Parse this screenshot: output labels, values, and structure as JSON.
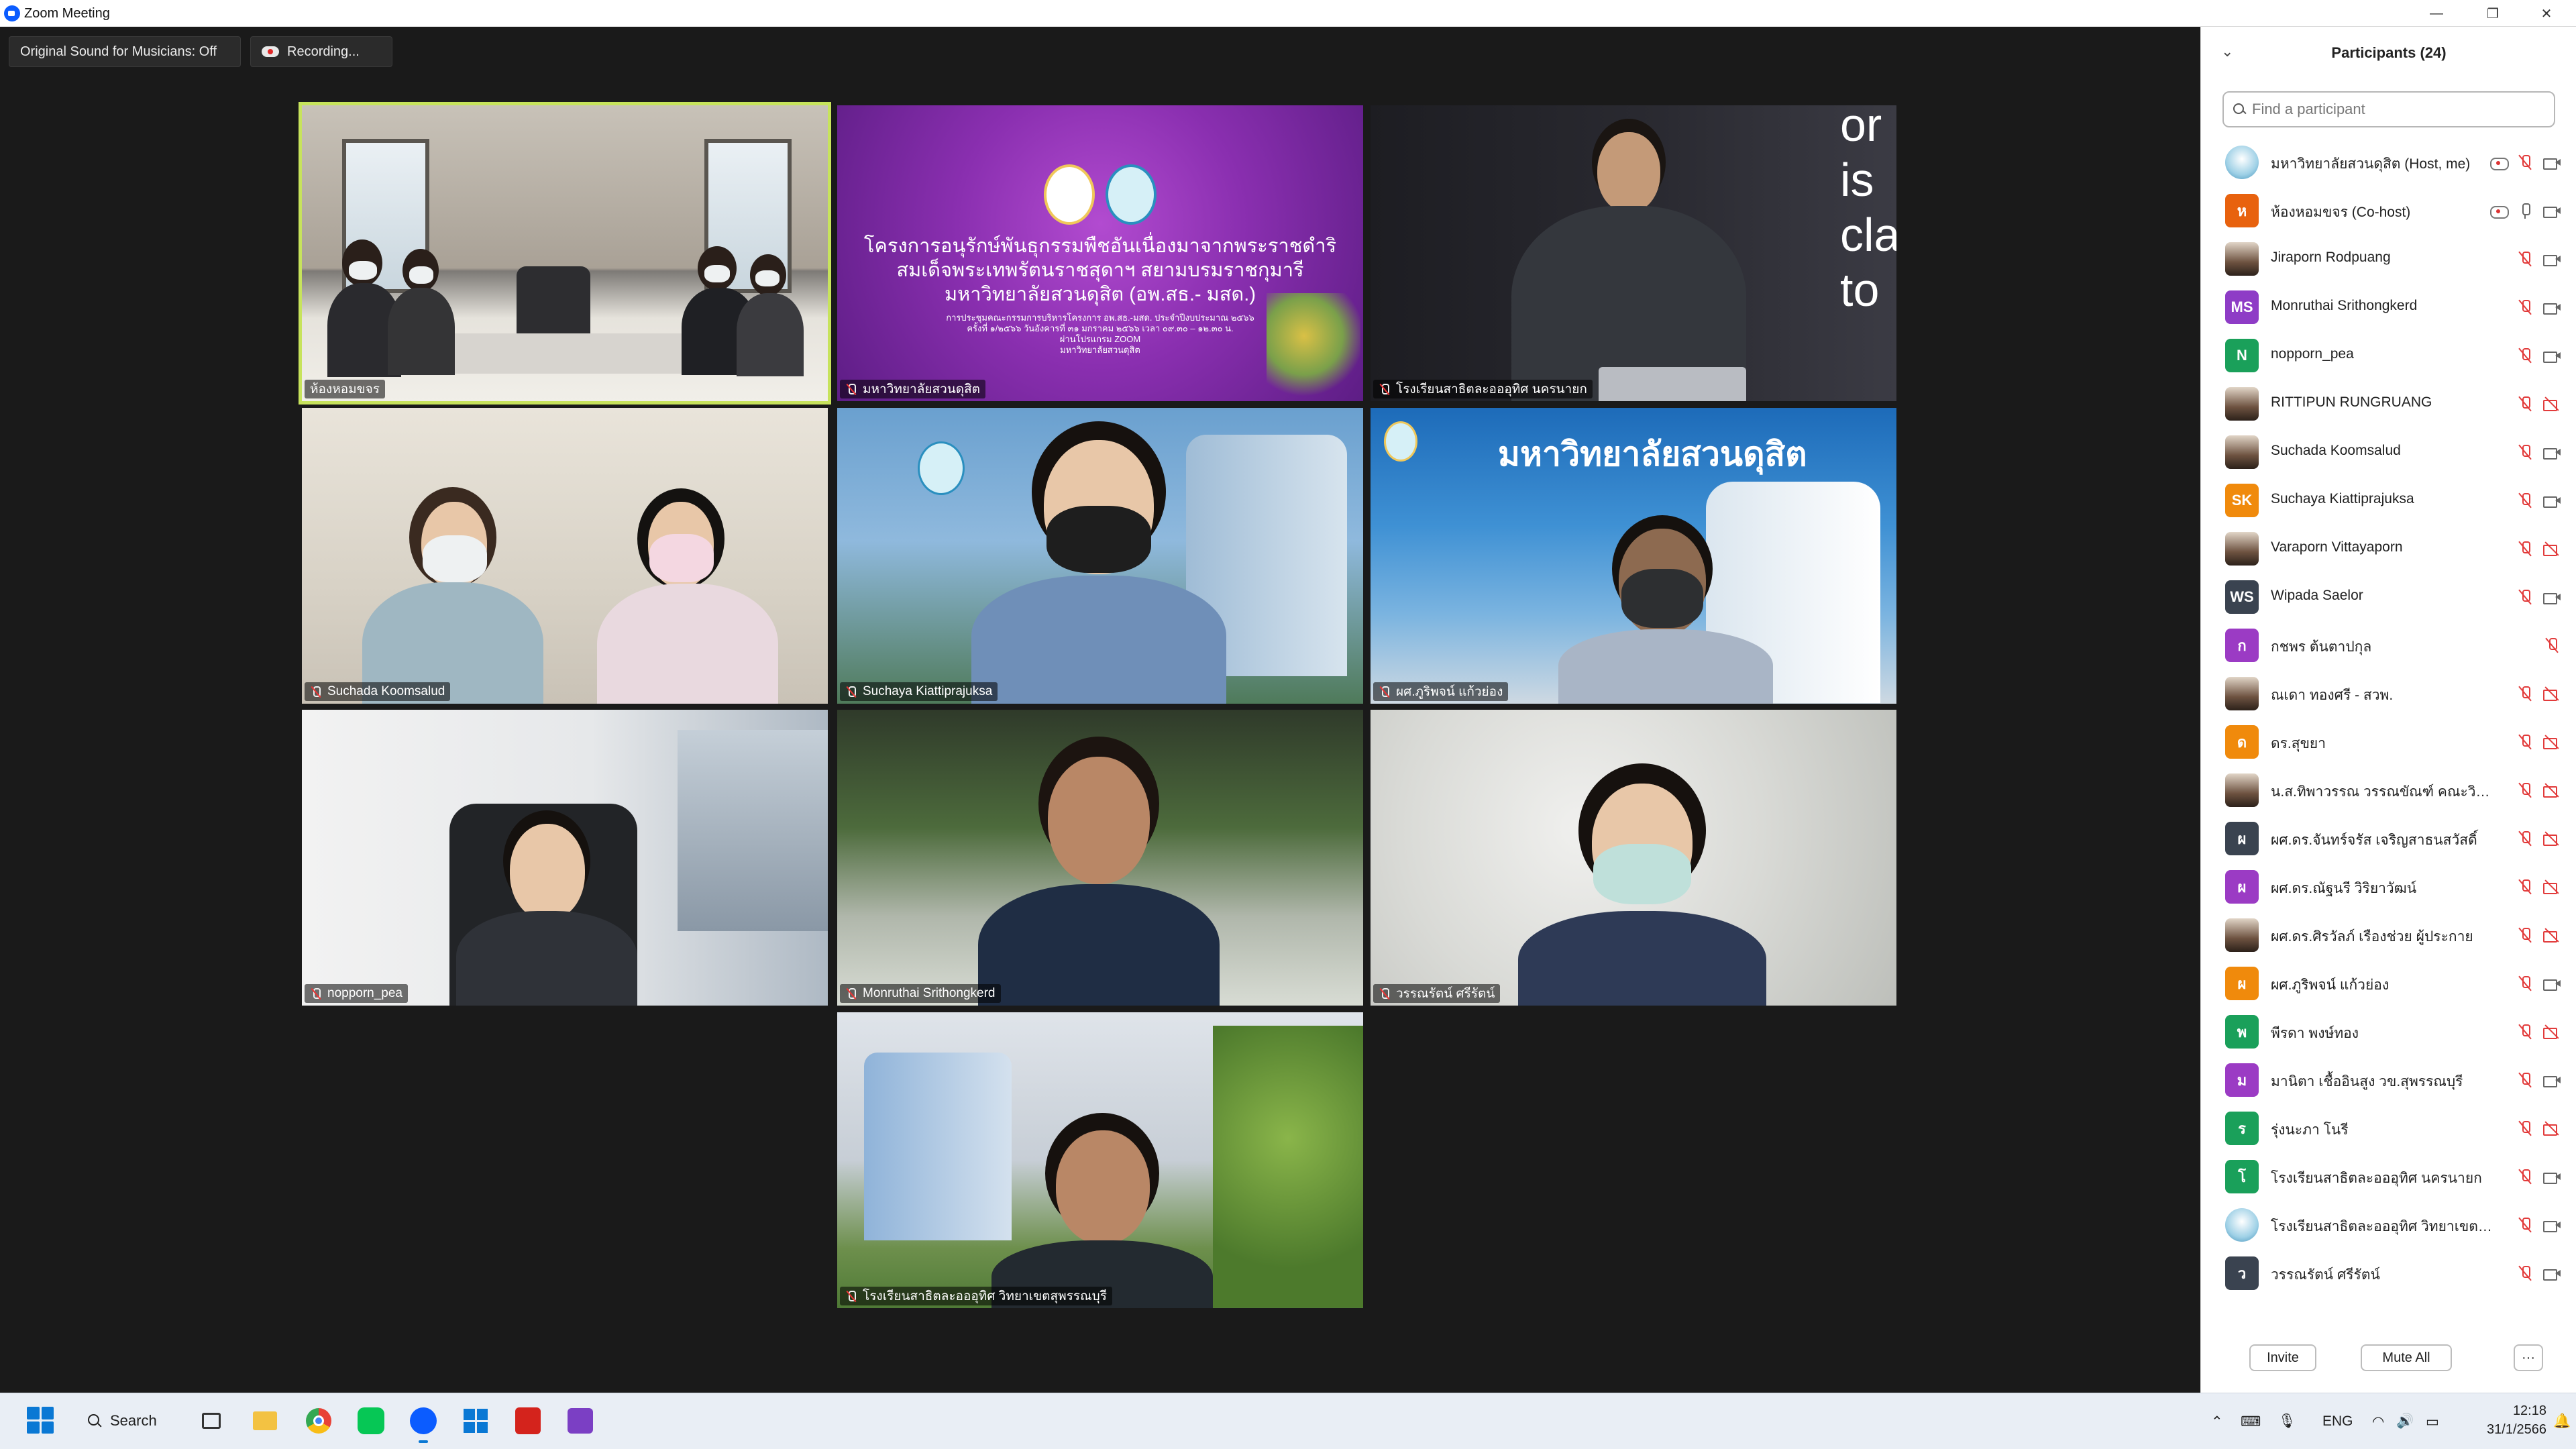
{
  "window": {
    "title": "Zoom Meeting"
  },
  "meeting": {
    "sound_label": "Original Sound for Musicians: Off",
    "recording_label": "Recording...",
    "slide": {
      "line1": "โครงการอนุรักษ์พันธุกรรมพืชอันเนื่องมาจากพระราชดำริ",
      "line2": "สมเด็จพระเทพรัตนราชสุดาฯ สยามบรมราชกุมารี",
      "line3": "มหาวิทยาลัยสวนดุสิต (อพ.สธ.- มสด.)",
      "small1": "การประชุมคณะกรรมการบริหารโครงการ อพ.สธ.-มสด. ประจำปีงบประมาณ ๒๕๖๖",
      "small2": "ครั้งที่ ๑/๒๕๖๖ วันอังคารที่ ๓๑ มกราคม ๒๕๖๖ เวลา ๐๙.๓๐ – ๑๒.๓๐ น.",
      "small3": "ผ่านโปรแกรม ZOOM",
      "small4": "มหาวิทยาลัยสวนดุสิต"
    },
    "board_text": [
      "or",
      "is",
      "cla",
      "to"
    ],
    "banner_text": "มหาวิทยาลัยสวนดุสิต",
    "tiles": [
      {
        "name": "ห้องหอมขจร",
        "muted": false,
        "active": true
      },
      {
        "name": "มหาวิทยาลัยสวนดุสิต",
        "muted": true
      },
      {
        "name": "โรงเรียนสาธิตละอออุทิศ นครนายก",
        "muted": true
      },
      {
        "name": "Suchada Koomsalud",
        "muted": true
      },
      {
        "name": "Suchaya Kiattiprajuksa",
        "muted": true
      },
      {
        "name": "ผศ.ภูริพจน์ แก้วย่อง",
        "muted": true
      },
      {
        "name": "nopporn_pea",
        "muted": true
      },
      {
        "name": "Monruthai Srithongkerd",
        "muted": true
      },
      {
        "name": "วรรณรัตน์ ศรีรัตน์",
        "muted": true
      },
      {
        "name": "โรงเรียนสาธิตละอออุทิศ วิทยาเขตสุพรรณบุรี",
        "muted": true
      }
    ]
  },
  "panel": {
    "title": "Participants (24)",
    "search_placeholder": "Find a participant",
    "participants": [
      {
        "name": "มหาวิทยาลัยสวนดุสิต (Host, me)",
        "avatar": "",
        "avatar_color": "#5aa7d0",
        "avatar_type": "photo-round",
        "icons": [
          "rec",
          "micoff",
          "vid"
        ]
      },
      {
        "name": "ห้องหอมขจร (Co-host)",
        "avatar": "ห",
        "avatar_color": "#e8620e",
        "avatar_type": "letter",
        "icons": [
          "rec",
          "mic",
          "vid"
        ]
      },
      {
        "name": "Jiraporn Rodpuang",
        "avatar": "",
        "avatar_color": "#ffffff",
        "avatar_type": "photo",
        "icons": [
          "micoff",
          "vid"
        ]
      },
      {
        "name": "Monruthai Srithongkerd",
        "avatar": "MS",
        "avatar_color": "#8e3cc6",
        "avatar_type": "letter",
        "icons": [
          "micoff",
          "vid"
        ]
      },
      {
        "name": "nopporn_pea",
        "avatar": "N",
        "avatar_color": "#1aa05a",
        "avatar_type": "letter",
        "icons": [
          "micoff",
          "vid"
        ]
      },
      {
        "name": "RITTIPUN RUNGRUANG",
        "avatar": "",
        "avatar_color": "#555555",
        "avatar_type": "photo",
        "icons": [
          "micoff",
          "vidoff"
        ]
      },
      {
        "name": "Suchada Koomsalud",
        "avatar": "",
        "avatar_color": "#ffffff",
        "avatar_type": "photo",
        "icons": [
          "micoff",
          "vid"
        ]
      },
      {
        "name": "Suchaya Kiattiprajuksa",
        "avatar": "SK",
        "avatar_color": "#f08a0c",
        "avatar_type": "letter",
        "icons": [
          "micoff",
          "vid"
        ]
      },
      {
        "name": "Varaporn Vittayaporn",
        "avatar": "",
        "avatar_color": "#ffffff",
        "avatar_type": "photo",
        "icons": [
          "micoff",
          "vidoff"
        ]
      },
      {
        "name": "Wipada Saelor",
        "avatar": "WS",
        "avatar_color": "#3a4350",
        "avatar_type": "letter",
        "icons": [
          "micoff",
          "vid"
        ]
      },
      {
        "name": "กชพร ต้นตาปกุล",
        "avatar": "ก",
        "avatar_color": "#9b3bc4",
        "avatar_type": "letter",
        "icons": [
          "micoff"
        ]
      },
      {
        "name": "ณเดา ทองศรี - สวพ.",
        "avatar": "",
        "avatar_color": "#ffffff",
        "avatar_type": "photo",
        "icons": [
          "micoff",
          "vidoff"
        ]
      },
      {
        "name": "ดร.สุขยา",
        "avatar": "ด",
        "avatar_color": "#f08a0c",
        "avatar_type": "letter",
        "icons": [
          "micoff",
          "vidoff"
        ]
      },
      {
        "name": "น.ส.ทิพาวรรณ วรรณขัณฑ์ คณะวิทยา...",
        "avatar": "",
        "avatar_color": "#ffffff",
        "avatar_type": "photo",
        "icons": [
          "micoff",
          "vidoff"
        ]
      },
      {
        "name": "ผศ.ดร.จันทร์จรัส เจริญสาธนสวัสดิ์",
        "avatar": "ผ",
        "avatar_color": "#3a4350",
        "avatar_type": "letter",
        "icons": [
          "micoff",
          "vidoff"
        ]
      },
      {
        "name": "ผศ.ดร.ณัฐนรี วิริยาวัฒน์",
        "avatar": "ผ",
        "avatar_color": "#9b3bc4",
        "avatar_type": "letter",
        "icons": [
          "micoff",
          "vidoff"
        ]
      },
      {
        "name": "ผศ.ดร.ศิรวัลภ์ เรืองช่วย ผู้ประกาย",
        "avatar": "",
        "avatar_color": "#ffffff",
        "avatar_type": "photo",
        "icons": [
          "micoff",
          "vidoff"
        ]
      },
      {
        "name": "ผศ.ภูริพจน์ แก้วย่อง",
        "avatar": "ผ",
        "avatar_color": "#f08a0c",
        "avatar_type": "letter",
        "icons": [
          "micoff",
          "vid"
        ]
      },
      {
        "name": "พีรดา พงษ์ทอง",
        "avatar": "พ",
        "avatar_color": "#1aa05a",
        "avatar_type": "letter",
        "icons": [
          "micoff",
          "vidoff"
        ]
      },
      {
        "name": "มานิตา เชื้ออินสูง วข.สุพรรณบุรี",
        "avatar": "ม",
        "avatar_color": "#9b3bc4",
        "avatar_type": "letter",
        "icons": [
          "micoff",
          "vid"
        ]
      },
      {
        "name": "รุ่งนะภา โนรี",
        "avatar": "ร",
        "avatar_color": "#1aa05a",
        "avatar_type": "letter",
        "icons": [
          "micoff",
          "vidoff"
        ]
      },
      {
        "name": "โรงเรียนสาธิตละอออุทิศ นครนายก",
        "avatar": "โ",
        "avatar_color": "#1aa05a",
        "avatar_type": "letter",
        "icons": [
          "micoff",
          "vid"
        ]
      },
      {
        "name": "โรงเรียนสาธิตละอออุทิศ วิทยาเขตสุพรร...",
        "avatar": "",
        "avatar_color": "#cfe6f2",
        "avatar_type": "photo-round",
        "icons": [
          "micoff",
          "vid"
        ]
      },
      {
        "name": "วรรณรัตน์ ศรีรัตน์",
        "avatar": "ว",
        "avatar_color": "#3a4350",
        "avatar_type": "letter",
        "icons": [
          "micoff",
          "vid"
        ]
      }
    ],
    "invite_label": "Invite",
    "mute_all_label": "Mute All",
    "more_label": "···"
  },
  "taskbar": {
    "search_label": "Search",
    "apps": [
      "task-view",
      "file-explorer",
      "chrome",
      "line",
      "zoom",
      "store",
      "acrobat",
      "visual-studio"
    ],
    "lang": "ENG",
    "time": "12:18",
    "date": "31/1/2566"
  }
}
